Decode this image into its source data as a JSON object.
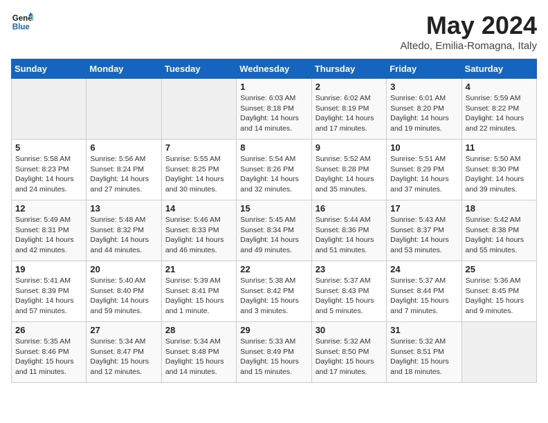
{
  "header": {
    "logo_line1": "General",
    "logo_line2": "Blue",
    "month": "May 2024",
    "location": "Altedo, Emilia-Romagna, Italy"
  },
  "days_of_week": [
    "Sunday",
    "Monday",
    "Tuesday",
    "Wednesday",
    "Thursday",
    "Friday",
    "Saturday"
  ],
  "weeks": [
    [
      {
        "day": "",
        "content": ""
      },
      {
        "day": "",
        "content": ""
      },
      {
        "day": "",
        "content": ""
      },
      {
        "day": "1",
        "content": "Sunrise: 6:03 AM\nSunset: 8:18 PM\nDaylight: 14 hours\nand 14 minutes."
      },
      {
        "day": "2",
        "content": "Sunrise: 6:02 AM\nSunset: 8:19 PM\nDaylight: 14 hours\nand 17 minutes."
      },
      {
        "day": "3",
        "content": "Sunrise: 6:01 AM\nSunset: 8:20 PM\nDaylight: 14 hours\nand 19 minutes."
      },
      {
        "day": "4",
        "content": "Sunrise: 5:59 AM\nSunset: 8:22 PM\nDaylight: 14 hours\nand 22 minutes."
      }
    ],
    [
      {
        "day": "5",
        "content": "Sunrise: 5:58 AM\nSunset: 8:23 PM\nDaylight: 14 hours\nand 24 minutes."
      },
      {
        "day": "6",
        "content": "Sunrise: 5:56 AM\nSunset: 8:24 PM\nDaylight: 14 hours\nand 27 minutes."
      },
      {
        "day": "7",
        "content": "Sunrise: 5:55 AM\nSunset: 8:25 PM\nDaylight: 14 hours\nand 30 minutes."
      },
      {
        "day": "8",
        "content": "Sunrise: 5:54 AM\nSunset: 8:26 PM\nDaylight: 14 hours\nand 32 minutes."
      },
      {
        "day": "9",
        "content": "Sunrise: 5:52 AM\nSunset: 8:28 PM\nDaylight: 14 hours\nand 35 minutes."
      },
      {
        "day": "10",
        "content": "Sunrise: 5:51 AM\nSunset: 8:29 PM\nDaylight: 14 hours\nand 37 minutes."
      },
      {
        "day": "11",
        "content": "Sunrise: 5:50 AM\nSunset: 8:30 PM\nDaylight: 14 hours\nand 39 minutes."
      }
    ],
    [
      {
        "day": "12",
        "content": "Sunrise: 5:49 AM\nSunset: 8:31 PM\nDaylight: 14 hours\nand 42 minutes."
      },
      {
        "day": "13",
        "content": "Sunrise: 5:48 AM\nSunset: 8:32 PM\nDaylight: 14 hours\nand 44 minutes."
      },
      {
        "day": "14",
        "content": "Sunrise: 5:46 AM\nSunset: 8:33 PM\nDaylight: 14 hours\nand 46 minutes."
      },
      {
        "day": "15",
        "content": "Sunrise: 5:45 AM\nSunset: 8:34 PM\nDaylight: 14 hours\nand 49 minutes."
      },
      {
        "day": "16",
        "content": "Sunrise: 5:44 AM\nSunset: 8:36 PM\nDaylight: 14 hours\nand 51 minutes."
      },
      {
        "day": "17",
        "content": "Sunrise: 5:43 AM\nSunset: 8:37 PM\nDaylight: 14 hours\nand 53 minutes."
      },
      {
        "day": "18",
        "content": "Sunrise: 5:42 AM\nSunset: 8:38 PM\nDaylight: 14 hours\nand 55 minutes."
      }
    ],
    [
      {
        "day": "19",
        "content": "Sunrise: 5:41 AM\nSunset: 8:39 PM\nDaylight: 14 hours\nand 57 minutes."
      },
      {
        "day": "20",
        "content": "Sunrise: 5:40 AM\nSunset: 8:40 PM\nDaylight: 14 hours\nand 59 minutes."
      },
      {
        "day": "21",
        "content": "Sunrise: 5:39 AM\nSunset: 8:41 PM\nDaylight: 15 hours\nand 1 minute."
      },
      {
        "day": "22",
        "content": "Sunrise: 5:38 AM\nSunset: 8:42 PM\nDaylight: 15 hours\nand 3 minutes."
      },
      {
        "day": "23",
        "content": "Sunrise: 5:37 AM\nSunset: 8:43 PM\nDaylight: 15 hours\nand 5 minutes."
      },
      {
        "day": "24",
        "content": "Sunrise: 5:37 AM\nSunset: 8:44 PM\nDaylight: 15 hours\nand 7 minutes."
      },
      {
        "day": "25",
        "content": "Sunrise: 5:36 AM\nSunset: 8:45 PM\nDaylight: 15 hours\nand 9 minutes."
      }
    ],
    [
      {
        "day": "26",
        "content": "Sunrise: 5:35 AM\nSunset: 8:46 PM\nDaylight: 15 hours\nand 11 minutes."
      },
      {
        "day": "27",
        "content": "Sunrise: 5:34 AM\nSunset: 8:47 PM\nDaylight: 15 hours\nand 12 minutes."
      },
      {
        "day": "28",
        "content": "Sunrise: 5:34 AM\nSunset: 8:48 PM\nDaylight: 15 hours\nand 14 minutes."
      },
      {
        "day": "29",
        "content": "Sunrise: 5:33 AM\nSunset: 8:49 PM\nDaylight: 15 hours\nand 15 minutes."
      },
      {
        "day": "30",
        "content": "Sunrise: 5:32 AM\nSunset: 8:50 PM\nDaylight: 15 hours\nand 17 minutes."
      },
      {
        "day": "31",
        "content": "Sunrise: 5:32 AM\nSunset: 8:51 PM\nDaylight: 15 hours\nand 18 minutes."
      },
      {
        "day": "",
        "content": ""
      }
    ]
  ]
}
